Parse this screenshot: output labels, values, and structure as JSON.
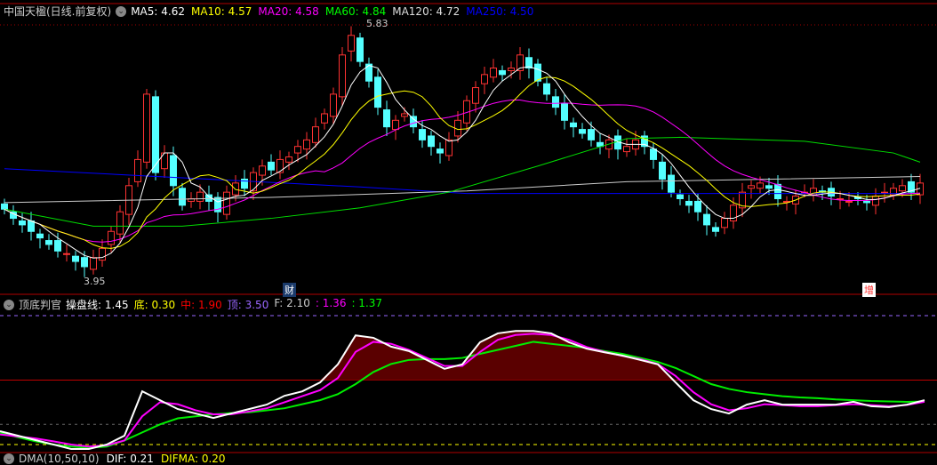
{
  "main": {
    "title": "中国天楹(日线.前复权)",
    "ma_labels": [
      {
        "text": "MA5: 4.62",
        "color": "#ffffff"
      },
      {
        "text": "MA10: 4.57",
        "color": "#ffff00"
      },
      {
        "text": "MA20: 4.58",
        "color": "#ff00ff"
      },
      {
        "text": "MA60: 4.84",
        "color": "#00ff00"
      },
      {
        "text": "MA120: 4.72",
        "color": "#dddddd"
      },
      {
        "text": "MA250: 4.50",
        "color": "#0000ff"
      }
    ],
    "high_label": "5.83",
    "low_label": "3.95",
    "marker_cai": "财",
    "marker_zeng": "增",
    "price_range": [
      3.95,
      5.83
    ],
    "closes": [
      4.42,
      4.35,
      4.3,
      4.25,
      4.2,
      4.15,
      4.1,
      4.08,
      4.02,
      3.98,
      4.05,
      4.12,
      4.25,
      4.4,
      4.6,
      4.8,
      5.3,
      4.7,
      4.85,
      4.6,
      4.45,
      4.5,
      4.55,
      4.48,
      4.4,
      4.55,
      4.62,
      4.58,
      4.7,
      4.75,
      4.72,
      4.8,
      4.82,
      4.9,
      4.95,
      5.05,
      5.15,
      5.3,
      5.6,
      5.75,
      5.55,
      5.4,
      5.2,
      5.05,
      5.1,
      5.15,
      5.05,
      4.95,
      4.9,
      4.85,
      4.95,
      5.1,
      5.25,
      5.35,
      5.45,
      5.5,
      5.45,
      5.5,
      5.6,
      5.5,
      5.4,
      5.3,
      5.2,
      5.1,
      5.05,
      5.0,
      4.95,
      4.9,
      4.95,
      4.88,
      4.9,
      4.95,
      4.9,
      4.8,
      4.65,
      4.55,
      4.5,
      4.45,
      4.4,
      4.3,
      4.25,
      4.35,
      4.45,
      4.55,
      4.6,
      4.62,
      4.58,
      4.5,
      4.48,
      4.52,
      4.55,
      4.58,
      4.55,
      4.52,
      4.5,
      4.48,
      4.5,
      4.47,
      4.52,
      4.55,
      4.58,
      4.6,
      4.55,
      4.62
    ],
    "ma60_points": [
      [
        0,
        4.42
      ],
      [
        10,
        4.29
      ],
      [
        20,
        4.29
      ],
      [
        30,
        4.35
      ],
      [
        40,
        4.43
      ],
      [
        50,
        4.55
      ],
      [
        60,
        4.75
      ],
      [
        70,
        4.96
      ],
      [
        76,
        4.97
      ],
      [
        90,
        4.94
      ],
      [
        100,
        4.85
      ],
      [
        103,
        4.78
      ]
    ],
    "ma120_points": [
      [
        0,
        4.47
      ],
      [
        30,
        4.51
      ],
      [
        52,
        4.56
      ],
      [
        70,
        4.63
      ],
      [
        103,
        4.67
      ]
    ],
    "ma250_points": [
      [
        0,
        4.73
      ],
      [
        40,
        4.59
      ],
      [
        52,
        4.54
      ],
      [
        103,
        4.54
      ]
    ]
  },
  "indicator": {
    "name": "顶底判官",
    "labels": [
      {
        "text": "操盘线: 1.45",
        "color": "#ffffff"
      },
      {
        "text": "底: 0.30",
        "color": "#ffff00"
      },
      {
        "text": "中: 1.90",
        "color": "#ff0000"
      },
      {
        "text": "顶: 3.50",
        "color": "#9966ff"
      },
      {
        "text": "F: 2.10",
        "color": "#cccccc"
      },
      {
        "text": ": 1.36",
        "color": "#ff00ff"
      },
      {
        "text": ": 1.37",
        "color": "#00ff00"
      }
    ],
    "levels": {
      "top": 3.5,
      "mid": 1.9,
      "f": 2.1,
      "bottom": 0.3
    },
    "white": [
      0.63,
      0.52,
      0.41,
      0.3,
      0.19,
      0.19,
      0.3,
      0.52,
      1.62,
      1.4,
      1.18,
      1.07,
      0.96,
      1.07,
      1.18,
      1.29,
      1.51,
      1.62,
      1.84,
      2.29,
      3.01,
      2.95,
      2.73,
      2.62,
      2.4,
      2.18,
      2.29,
      2.84,
      3.06,
      3.12,
      3.12,
      3.06,
      2.84,
      2.68,
      2.59,
      2.51,
      2.4,
      2.29,
      1.84,
      1.4,
      1.18,
      1.07,
      1.29,
      1.4,
      1.29,
      1.29,
      1.29,
      1.29,
      1.36,
      1.25,
      1.23,
      1.29,
      1.4
    ],
    "magenta": [
      0.55,
      0.5,
      0.45,
      0.38,
      0.3,
      0.25,
      0.28,
      0.4,
      1.0,
      1.35,
      1.3,
      1.15,
      1.05,
      1.05,
      1.12,
      1.2,
      1.35,
      1.5,
      1.65,
      1.95,
      2.6,
      2.85,
      2.8,
      2.65,
      2.45,
      2.25,
      2.25,
      2.6,
      2.9,
      3.02,
      3.05,
      3.02,
      2.9,
      2.72,
      2.6,
      2.5,
      2.42,
      2.3,
      2.0,
      1.6,
      1.3,
      1.15,
      1.2,
      1.3,
      1.28,
      1.25,
      1.25,
      1.28,
      1.3,
      1.28,
      1.25,
      1.28,
      1.36
    ],
    "green": [
      0.6,
      0.48,
      0.38,
      0.3,
      0.25,
      0.22,
      0.25,
      0.4,
      0.6,
      0.8,
      0.95,
      1.0,
      1.05,
      1.08,
      1.1,
      1.15,
      1.2,
      1.3,
      1.4,
      1.55,
      1.8,
      2.1,
      2.3,
      2.4,
      2.42,
      2.42,
      2.45,
      2.55,
      2.65,
      2.75,
      2.85,
      2.8,
      2.75,
      2.7,
      2.62,
      2.55,
      2.45,
      2.35,
      2.2,
      2.0,
      1.8,
      1.68,
      1.6,
      1.55,
      1.5,
      1.47,
      1.45,
      1.42,
      1.4,
      1.38,
      1.37,
      1.36,
      1.37
    ]
  },
  "dma": {
    "labels": [
      {
        "text": "DMA(10,50,10)",
        "color": "#cccccc"
      },
      {
        "text": "DIF: 0.21",
        "color": "#ffffff"
      },
      {
        "text": "DIFMA: 0.20",
        "color": "#ffff00"
      }
    ]
  },
  "colors": {
    "up": "#ff3232",
    "down": "#54ffff",
    "border": "#b00000"
  }
}
